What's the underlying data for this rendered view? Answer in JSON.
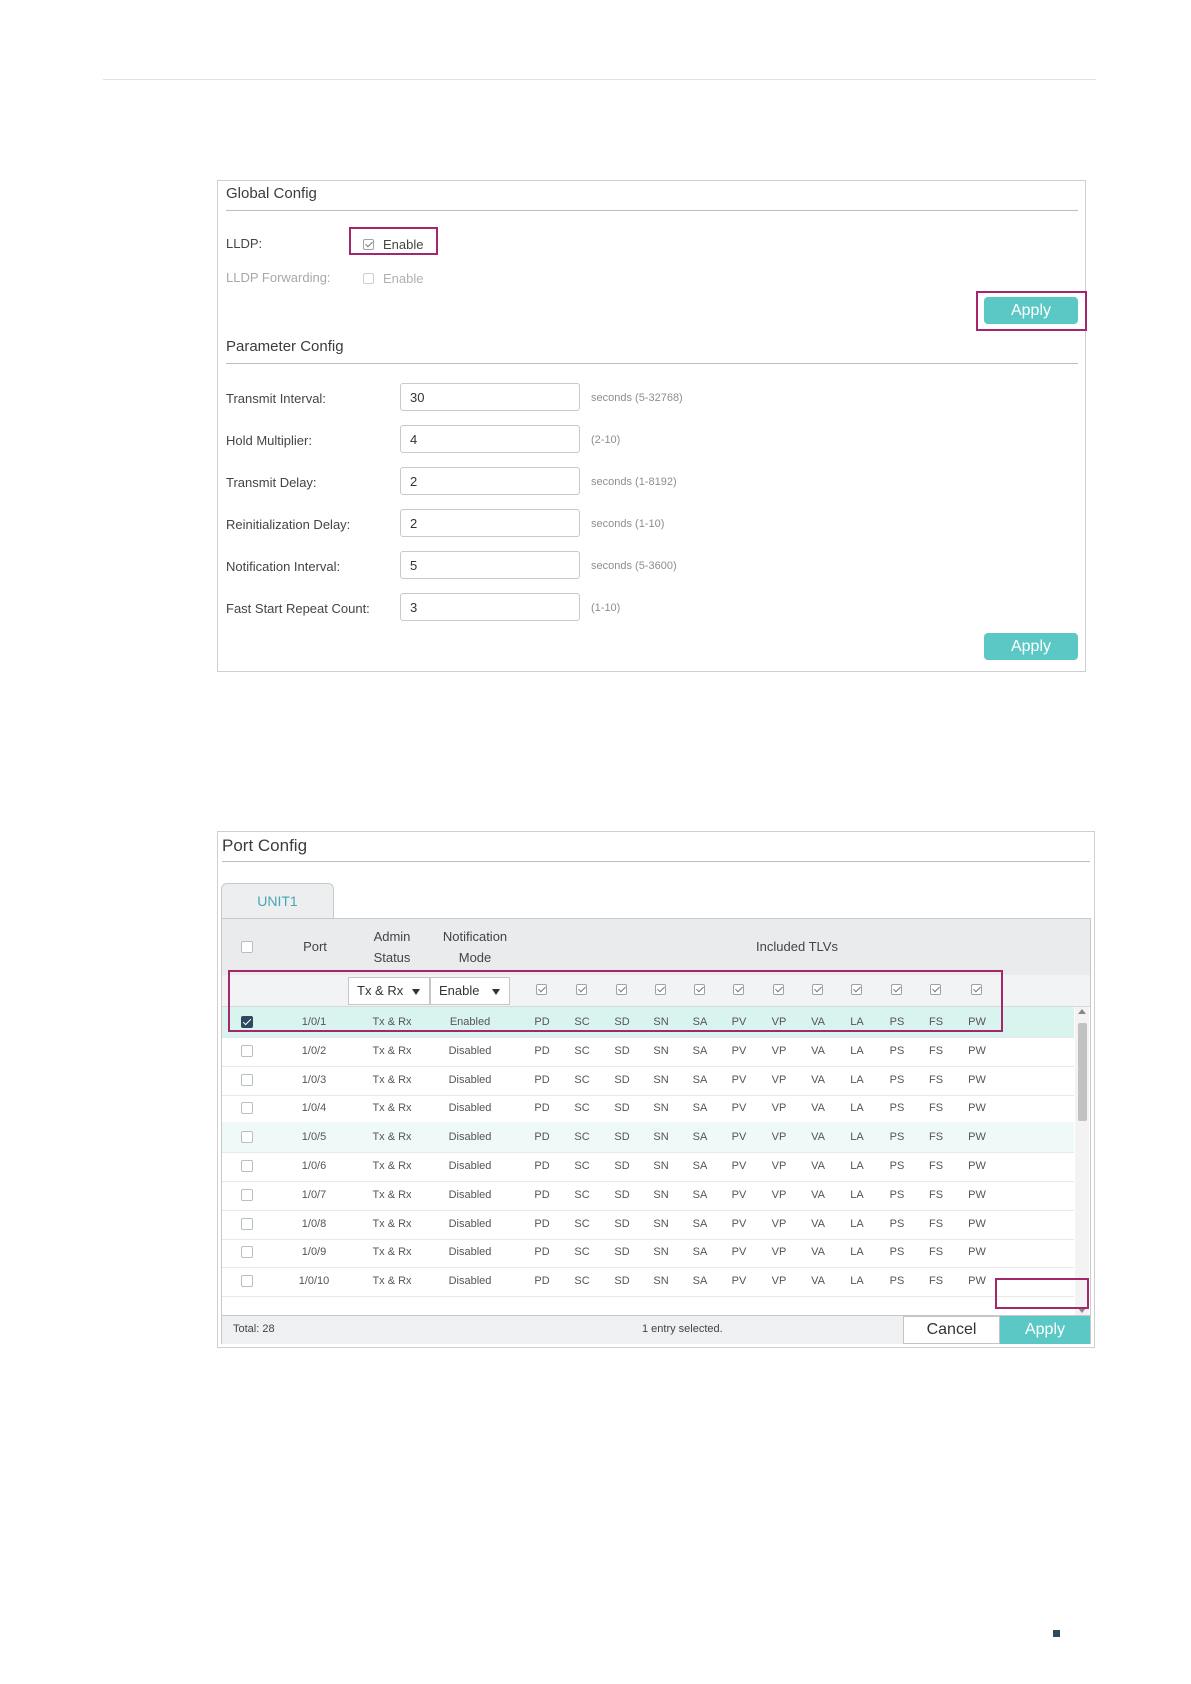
{
  "global_config": {
    "title": "Global Config",
    "lldp_label": "LLDP:",
    "lldp_option": "Enable",
    "lldp_checked": true,
    "lldp_forwarding_label": "LLDP Forwarding:",
    "lldp_forwarding_option": "Enable",
    "lldp_forwarding_checked": false,
    "apply_label": "Apply"
  },
  "parameter_config": {
    "title": "Parameter Config",
    "fields": [
      {
        "label": "Transmit Interval:",
        "value": "30",
        "hint": "seconds (5-32768)"
      },
      {
        "label": "Hold Multiplier:",
        "value": "4",
        "hint": "(2-10)"
      },
      {
        "label": "Transmit Delay:",
        "value": "2",
        "hint": "seconds (1-8192)"
      },
      {
        "label": "Reinitialization Delay:",
        "value": "2",
        "hint": "seconds (1-10)"
      },
      {
        "label": "Notification Interval:",
        "value": "5",
        "hint": "seconds (5-3600)"
      },
      {
        "label": "Fast Start Repeat Count:",
        "value": "3",
        "hint": "(1-10)"
      }
    ],
    "apply_label": "Apply"
  },
  "port_config": {
    "title": "Port Config",
    "tab": "UNIT1",
    "headers": {
      "port": "Port",
      "admin_status_1": "Admin",
      "admin_status_2": "Status",
      "notification_1": "Notification",
      "notification_2": "Mode",
      "included_tlvs": "Included TLVs"
    },
    "filter": {
      "admin_status": "Tx & Rx",
      "notification_mode": "Enable"
    },
    "tlvs": [
      "PD",
      "SC",
      "SD",
      "SN",
      "SA",
      "PV",
      "VP",
      "VA",
      "LA",
      "PS",
      "FS",
      "PW"
    ],
    "rows": [
      {
        "port": "1/0/1",
        "admin_status": "Tx & Rx",
        "notification": "Enabled",
        "checked": true
      },
      {
        "port": "1/0/2",
        "admin_status": "Tx & Rx",
        "notification": "Disabled",
        "checked": false
      },
      {
        "port": "1/0/3",
        "admin_status": "Tx & Rx",
        "notification": "Disabled",
        "checked": false
      },
      {
        "port": "1/0/4",
        "admin_status": "Tx & Rx",
        "notification": "Disabled",
        "checked": false
      },
      {
        "port": "1/0/5",
        "admin_status": "Tx & Rx",
        "notification": "Disabled",
        "checked": false
      },
      {
        "port": "1/0/6",
        "admin_status": "Tx & Rx",
        "notification": "Disabled",
        "checked": false
      },
      {
        "port": "1/0/7",
        "admin_status": "Tx & Rx",
        "notification": "Disabled",
        "checked": false
      },
      {
        "port": "1/0/8",
        "admin_status": "Tx & Rx",
        "notification": "Disabled",
        "checked": false
      },
      {
        "port": "1/0/9",
        "admin_status": "Tx & Rx",
        "notification": "Disabled",
        "checked": false
      },
      {
        "port": "1/0/10",
        "admin_status": "Tx & Rx",
        "notification": "Disabled",
        "checked": false
      }
    ],
    "total": "Total: 28",
    "selection": "1 entry selected.",
    "cancel_label": "Cancel",
    "apply_label": "Apply"
  },
  "colors": {
    "accent": "#5cc8c6",
    "highlight": "#a4266b",
    "selected_row": "#d9f3ef"
  }
}
